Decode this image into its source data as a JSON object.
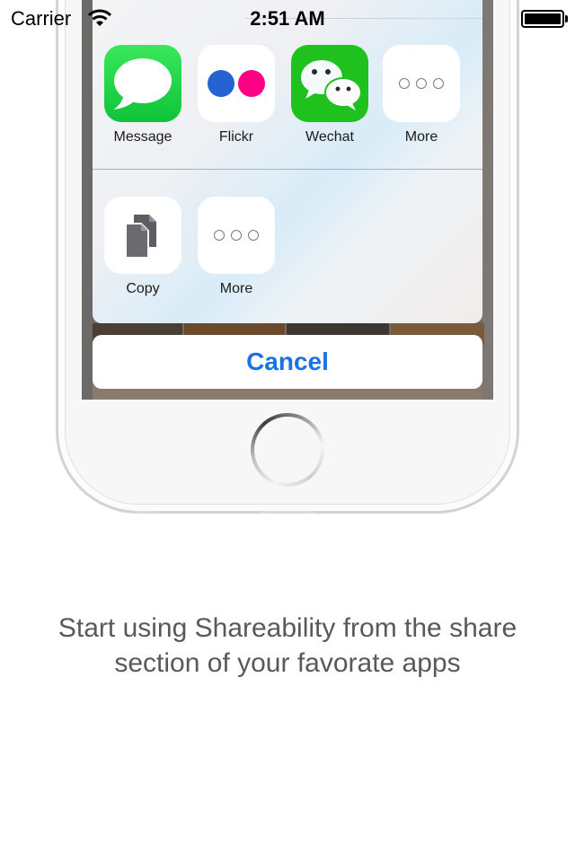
{
  "status_bar": {
    "carrier": "Carrier",
    "time": "2:51 AM",
    "wifi_icon": "wifi-icon",
    "battery_icon": "battery-full-icon"
  },
  "share_sheet": {
    "apps": [
      {
        "label": "Message",
        "icon": "message-bubble-icon",
        "color": "#1ec43f"
      },
      {
        "label": "Flickr",
        "icon": "flickr-dots-icon",
        "colors": [
          "#2364d2",
          "#ff0084"
        ]
      },
      {
        "label": "Wechat",
        "icon": "wechat-bubbles-icon",
        "color": "#1fc21c"
      },
      {
        "label": "More",
        "icon": "more-dots-icon"
      }
    ],
    "actions": [
      {
        "label": "Copy",
        "icon": "copy-documents-icon"
      },
      {
        "label": "More",
        "icon": "more-dots-icon"
      }
    ],
    "cancel_label": "Cancel",
    "accent_color": "#1a73e6"
  },
  "caption": "Start using Shareability from the share section of your favorate apps"
}
